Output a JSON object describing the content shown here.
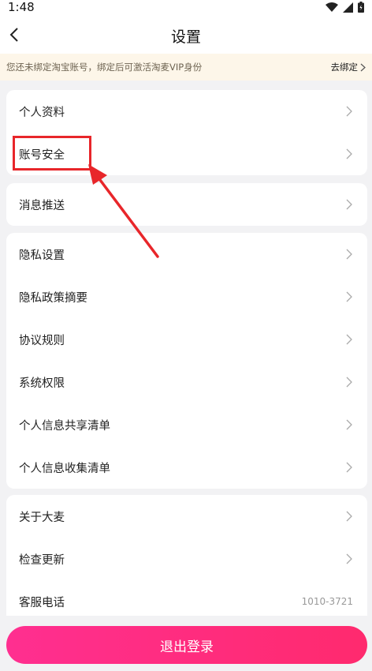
{
  "status_bar": {
    "time": "1:48"
  },
  "nav": {
    "title": "设置"
  },
  "notice": {
    "text": "您还未绑定淘宝账号，绑定后可激活淘麦VIP身份",
    "action": "去绑定"
  },
  "groups": [
    {
      "items": [
        {
          "label": "个人资料"
        },
        {
          "label": "账号安全"
        }
      ]
    },
    {
      "items": [
        {
          "label": "消息推送"
        }
      ]
    },
    {
      "items": [
        {
          "label": "隐私设置"
        },
        {
          "label": "隐私政策摘要"
        },
        {
          "label": "协议规则"
        },
        {
          "label": "系统权限"
        },
        {
          "label": "个人信息共享清单"
        },
        {
          "label": "个人信息收集清单"
        }
      ]
    },
    {
      "items": [
        {
          "label": "关于大麦"
        },
        {
          "label": "检查更新"
        },
        {
          "label": "客服电话",
          "value": "1010-3721"
        }
      ]
    }
  ],
  "logout": {
    "label": "退出登录"
  },
  "colors": {
    "accent": "#ff2f90",
    "annotation": "#e8262a",
    "notice_bg": "#fdf6e9"
  }
}
